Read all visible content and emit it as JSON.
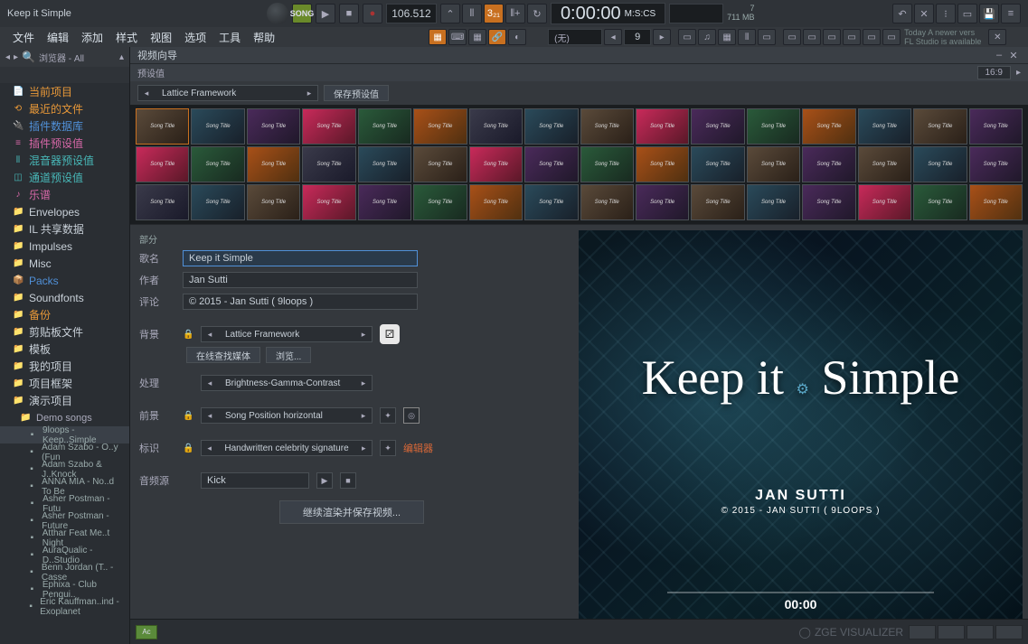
{
  "titlebar": {
    "project_title": "Keep it Simple",
    "song_btn": "SONG",
    "tempo": "106.512",
    "timecode": "0:00:00",
    "timecode_label": "M:S:CS",
    "stats_cpu": "7",
    "stats_mem": "711 MB",
    "hint_today": "Today  A newer vers",
    "hint_sub": "FL Studio is available"
  },
  "menubar": {
    "items": [
      "文件",
      "编辑",
      "添加",
      "样式",
      "视图",
      "选项",
      "工具",
      "帮助"
    ],
    "pattern": "(无)",
    "pattern_num": "9"
  },
  "browser": {
    "head": "浏览器 - All",
    "items": [
      {
        "label": "当前项目",
        "cls": "orange",
        "icon": "📄"
      },
      {
        "label": "最近的文件",
        "cls": "orange",
        "icon": "⟲"
      },
      {
        "label": "插件数据库",
        "cls": "blue",
        "icon": "🔌"
      },
      {
        "label": "插件预设值",
        "cls": "pink",
        "icon": "≡"
      },
      {
        "label": "混音器预设值",
        "cls": "teal",
        "icon": "⫴"
      },
      {
        "label": "通道预设值",
        "cls": "teal",
        "icon": "◫"
      },
      {
        "label": "乐谱",
        "cls": "pink",
        "icon": "♪"
      },
      {
        "label": "Envelopes",
        "cls": "",
        "icon": "📁"
      },
      {
        "label": "IL 共享数据",
        "cls": "",
        "icon": "📁"
      },
      {
        "label": "Impulses",
        "cls": "",
        "icon": "📁"
      },
      {
        "label": "Misc",
        "cls": "",
        "icon": "📁"
      },
      {
        "label": "Packs",
        "cls": "blue",
        "icon": "📦"
      },
      {
        "label": "Soundfonts",
        "cls": "",
        "icon": "📁"
      },
      {
        "label": "备份",
        "cls": "orange",
        "icon": "📁"
      },
      {
        "label": "剪贴板文件",
        "cls": "",
        "icon": "📁"
      },
      {
        "label": "模板",
        "cls": "",
        "icon": "📁"
      },
      {
        "label": "我的项目",
        "cls": "",
        "icon": "📁"
      },
      {
        "label": "项目框架",
        "cls": "",
        "icon": "📁"
      },
      {
        "label": "演示项目",
        "cls": "",
        "icon": "📁"
      }
    ],
    "sub1": "Demo songs",
    "songs": [
      "9loops - Keep..Simple",
      "Adam Szabo - O..y (Fun",
      "Adam Szabo & J..Knock",
      "ANNA MIA - No..d To Be",
      "Asher Postman - Futu",
      "Asher Postman - Future",
      "Atthar Feat Me..t Night",
      "AuraQualic - D..Studio",
      "Benn Jordan (T.. - Casse",
      "Ephixa - Club Pengui..",
      "Eric Kauffman..ind - Exoplanet"
    ]
  },
  "wizard": {
    "title": "视频向导",
    "preset_label": "预设值",
    "aspect": "16:9",
    "preset_value": "Lattice Framework",
    "save_preset": "保存预设值",
    "section_label": "部分",
    "song_label": "歌名",
    "song_value": "Keep it Simple",
    "author_label": "作者",
    "author_value": "Jan Sutti",
    "comment_label": "评论",
    "comment_value": "© 2015 - Jan Sutti ( 9loops )",
    "bg_label": "背景",
    "bg_value": "Lattice Framework",
    "search_online": "在线查找媒体",
    "browse": "浏览...",
    "process_label": "处理",
    "process_value": "Brightness-Gamma-Contrast",
    "fg_label": "前景",
    "fg_value": "Song Position horizontal",
    "sig_label": "标识",
    "sig_value": "Handwritten celebrity signature",
    "editor": "编辑器",
    "audio_label": "音频源",
    "audio_value": "Kick",
    "render": "继续渲染并保存视频..."
  },
  "preview": {
    "title_text": "Keep it Simple",
    "author": "JAN SUTTI",
    "copy": "© 2015 - JAN SUTTI ( 9LOOPS )",
    "time": "00:00"
  },
  "bottom": {
    "clip": "Ac",
    "zge": "ZGE VISUALIZER"
  }
}
